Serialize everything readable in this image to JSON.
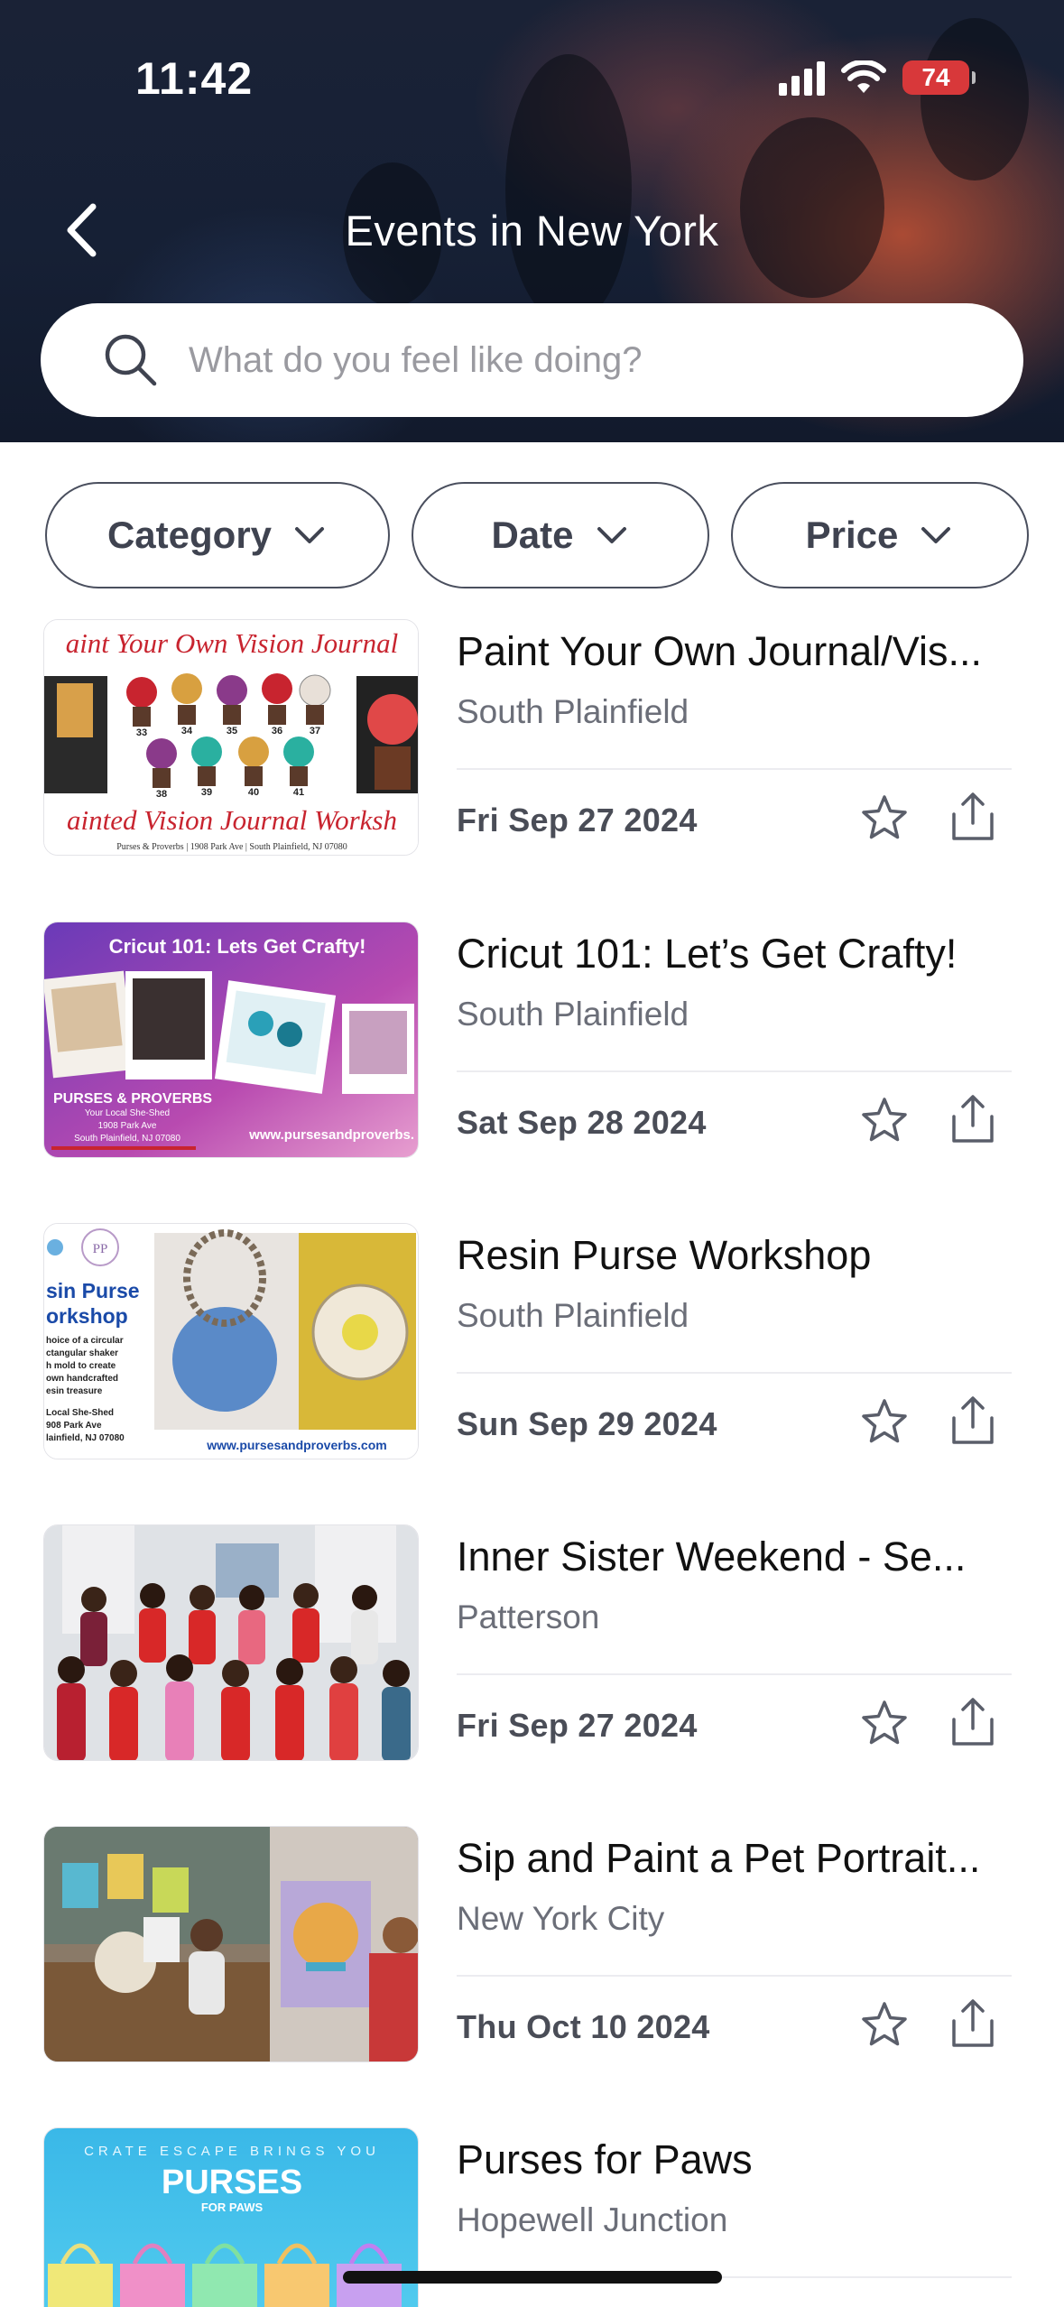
{
  "status_bar": {
    "time": "11:42",
    "battery": "74"
  },
  "header": {
    "title": "Events in New York"
  },
  "search": {
    "placeholder": "What do you feel like doing?"
  },
  "filters": [
    {
      "label": "Category"
    },
    {
      "label": "Date"
    },
    {
      "label": "Price"
    }
  ],
  "events": [
    {
      "title": "Paint Your Own Journal/Vis...",
      "location": "South Plainfield",
      "date": "Fri Sep 27 2024",
      "thumb": {
        "top_text": "aint Your Own Vision Journal",
        "bottom_text": "ainted Vision Journal Worksh",
        "footer": "Purses & Proverbs | 1908 Park Ave | South Plainfield, NJ 07080",
        "numbers": [
          "33",
          "34",
          "35",
          "36",
          "37",
          "38",
          "39",
          "40",
          "41"
        ]
      }
    },
    {
      "title": "Cricut 101: Let’s Get Crafty!",
      "location": "South Plainfield",
      "date": "Sat Sep 28 2024",
      "thumb": {
        "headline": "Cricut 101: Lets Get Crafty!",
        "brand": "PURSES & PROVERBS",
        "line1": "Your Local She-Shed",
        "line2": "1908 Park Ave",
        "line3": "South Plainfield, NJ 07080",
        "url": "www.pursesandproverbs."
      }
    },
    {
      "title": "Resin Purse Workshop",
      "location": "South Plainfield",
      "date": "Sun Sep 29 2024",
      "thumb": {
        "logo": "PP",
        "heading1": "sin Purse",
        "heading2": "orkshop",
        "desc1": "hoice of a circular",
        "desc2": "ctangular shaker",
        "desc3": "h mold to create",
        "desc4": "own handcrafted",
        "desc5": "esin treasure",
        "addr1": "Local She-Shed",
        "addr2": "908 Park Ave",
        "addr3": "lainfield, NJ 07080",
        "url": "www.pursesandproverbs.com"
      }
    },
    {
      "title": "Inner Sister Weekend - Se...",
      "location": "Patterson",
      "date": "Fri Sep 27 2024"
    },
    {
      "title": "Sip and Paint a Pet Portrait...",
      "location": "New York City",
      "date": "Thu Oct 10 2024"
    },
    {
      "title": "Purses for Paws",
      "location": "Hopewell Junction",
      "date": "",
      "thumb": {
        "tagline": "CRATE ESCAPE BRINGS YOU",
        "headline": "PURSES",
        "sub": "FOR PAWS"
      }
    }
  ],
  "colors": {
    "header_bg": "#162035",
    "accent_red": "#c8242f",
    "chip_border": "#4a4f5e",
    "text_secondary": "#6b6e78"
  }
}
